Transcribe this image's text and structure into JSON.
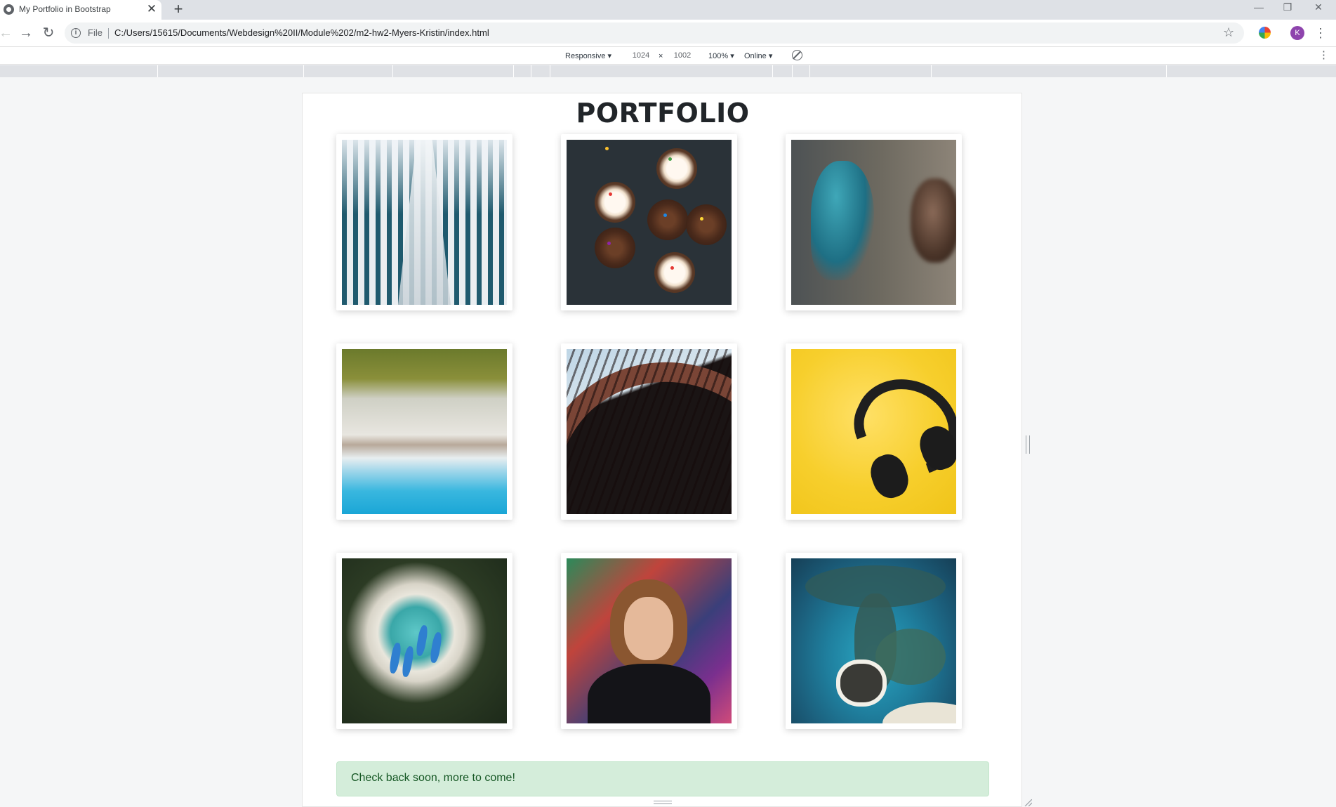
{
  "browser": {
    "tab_title": "My Portfolio in Bootstrap",
    "tab_close": "✕",
    "new_tab": "+",
    "window_controls": {
      "minimize": "—",
      "restore": "❐",
      "close": "✕"
    },
    "nav": {
      "back": "←",
      "forward": "→",
      "reload": "↻"
    },
    "omnibox": {
      "info_icon": "i",
      "scheme_label": "File",
      "url": "C:/Users/15615/Documents/Webdesign%20II/Module%202/m2-hw2-Myers-Kristin/index.html",
      "bookmark_icon": "☆"
    },
    "profile_initial": "K",
    "menu_icon": "⋮"
  },
  "device_toolbar": {
    "mode": "Responsive ▾",
    "width": "1024",
    "times": "×",
    "height": "1002",
    "zoom": "100% ▾",
    "network": "Online ▾",
    "menu_icon": "⋮"
  },
  "page": {
    "title": "PORTFOLIO",
    "photos": [
      {
        "subject": "building-looking-up"
      },
      {
        "subject": "cupcakes"
      },
      {
        "subject": "graffiti-wall"
      },
      {
        "subject": "aerial-beach"
      },
      {
        "subject": "curved-building"
      },
      {
        "subject": "headphones"
      },
      {
        "subject": "palm-beach-boats"
      },
      {
        "subject": "person-graffiti"
      },
      {
        "subject": "reef-island"
      }
    ],
    "alert": "Check back soon, more to come!"
  },
  "colors": {
    "alert_bg": "#d4edda",
    "alert_text": "#155724",
    "profile": "#8e44ad"
  }
}
